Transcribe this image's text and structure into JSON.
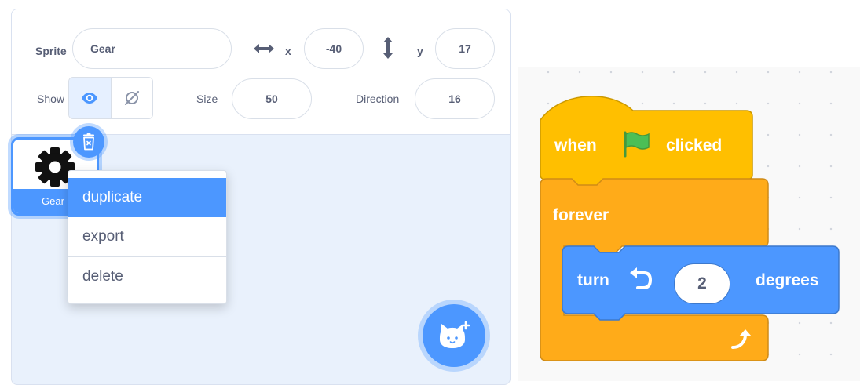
{
  "sprite_info": {
    "sprite_label": "Sprite",
    "sprite_name": "Gear",
    "x_label": "x",
    "x_value": "-40",
    "y_label": "y",
    "y_value": "17",
    "show_label": "Show",
    "size_label": "Size",
    "size_value": "50",
    "direction_label": "Direction",
    "direction_value": "16"
  },
  "sprite_list": {
    "sprites": [
      {
        "name": "Gear",
        "icon": "gear-icon",
        "selected": true
      }
    ]
  },
  "context_menu": {
    "items": [
      "duplicate",
      "export",
      "delete"
    ],
    "highlighted": "duplicate"
  },
  "code": {
    "hat_block": {
      "when": "when",
      "clicked": "clicked",
      "flag_icon": "green-flag-icon"
    },
    "forever_block": {
      "label": "forever",
      "loop_icon": "loop-arrow-icon"
    },
    "turn_block": {
      "turn": "turn",
      "rotate_icon": "rotate-left-icon",
      "amount": "2",
      "degrees": "degrees"
    }
  },
  "colors": {
    "accent": "#4c97ff",
    "events": "#ffbf00",
    "control": "#ffab19",
    "motion": "#4c97ff"
  }
}
